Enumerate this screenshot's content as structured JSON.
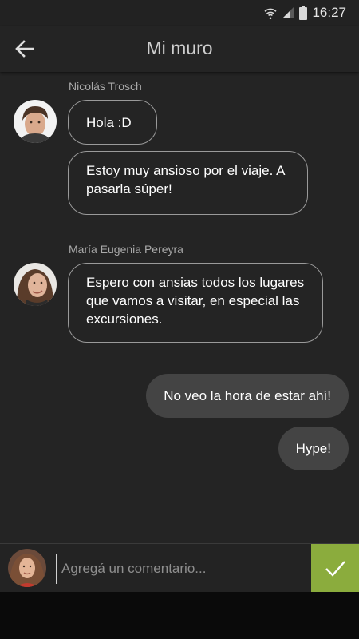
{
  "status_bar": {
    "time": "16:27",
    "icons": [
      "wifi-icon",
      "signal-icon",
      "battery-icon"
    ]
  },
  "app_bar": {
    "title": "Mi muro",
    "back_icon": "arrow-left-icon"
  },
  "messages": [
    {
      "sender": "Nicolás Trosch",
      "direction": "incoming",
      "bubbles": [
        {
          "text": "Hola :D"
        },
        {
          "text": "Estoy muy ansioso por el viaje. A pasarla súper!"
        }
      ]
    },
    {
      "sender": "María Eugenia Pereyra",
      "direction": "incoming",
      "bubbles": [
        {
          "text": "Espero con ansias todos los lugares que vamos a visitar, en especial las excursiones."
        }
      ]
    },
    {
      "direction": "outgoing",
      "bubbles": [
        {
          "text": "No veo la hora de estar ahí!"
        },
        {
          "text": "Hype!"
        }
      ]
    }
  ],
  "composer": {
    "placeholder": "Agregá un comentario...",
    "value": "",
    "send_icon": "checkmark-icon",
    "send_color": "#8bac3d"
  },
  "colors": {
    "background": "#242424",
    "outgoing_bubble": "#444444",
    "incoming_border": "#9a9a9a",
    "accent": "#8bac3d"
  }
}
